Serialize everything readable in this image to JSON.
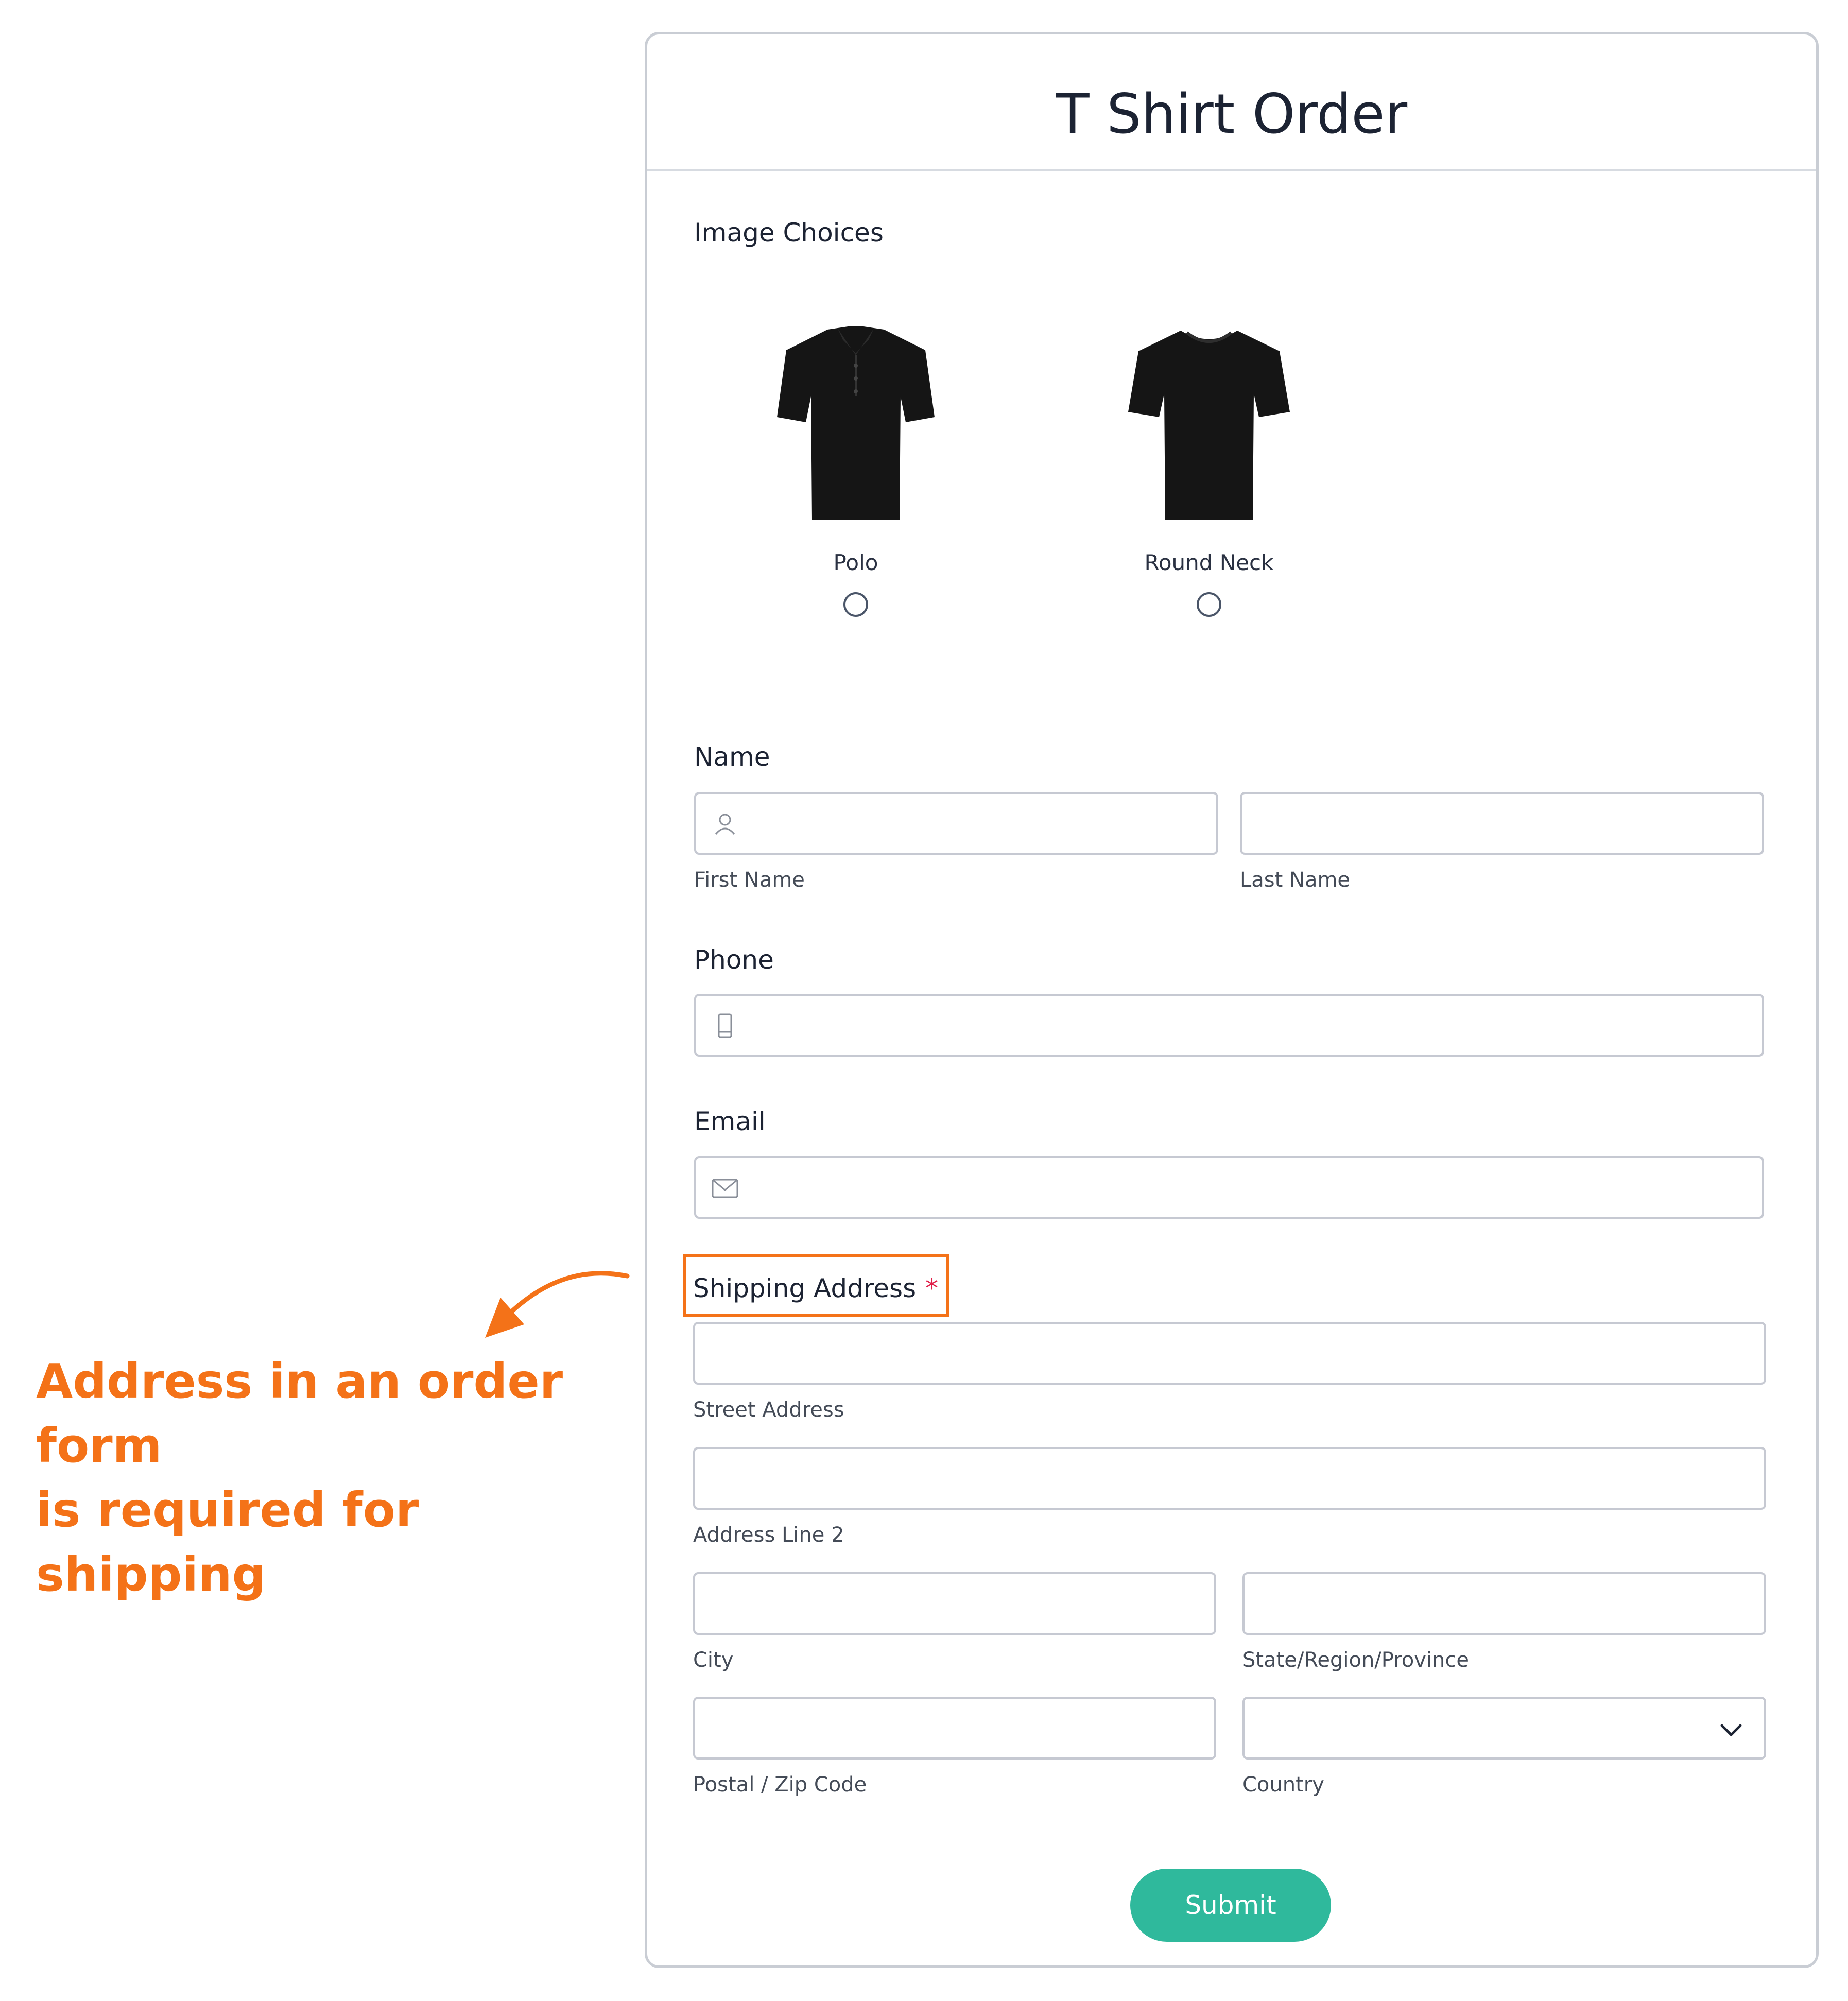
{
  "annotation": {
    "line1": "Address in an order form",
    "line2": "is required for shipping",
    "color": "#f47218"
  },
  "form": {
    "title": "T Shirt Order",
    "image_choices": {
      "label": "Image Choices",
      "options": [
        {
          "label": "Polo",
          "icon": "polo-shirt-icon",
          "selected": false
        },
        {
          "label": "Round Neck",
          "icon": "round-neck-shirt-icon",
          "selected": false
        }
      ]
    },
    "name": {
      "label": "Name",
      "first_name": {
        "sublabel": "First Name",
        "value": "",
        "icon": "user-icon"
      },
      "last_name": {
        "sublabel": "Last Name",
        "value": ""
      }
    },
    "phone": {
      "label": "Phone",
      "value": "",
      "icon": "phone-icon"
    },
    "email": {
      "label": "Email",
      "value": "",
      "icon": "mail-icon"
    },
    "shipping_address": {
      "label": "Shipping Address",
      "required_marker": "*",
      "street": {
        "sublabel": "Street Address",
        "value": ""
      },
      "line2": {
        "sublabel": "Address Line 2",
        "value": ""
      },
      "city": {
        "sublabel": "City",
        "value": ""
      },
      "state": {
        "sublabel": "State/Region/Province",
        "value": ""
      },
      "postal": {
        "sublabel": "Postal / Zip Code",
        "value": ""
      },
      "country": {
        "sublabel": "Country",
        "value": "",
        "icon": "chevron-down-icon"
      }
    },
    "submit_label": "Submit",
    "colors": {
      "accent": "#2fb99c",
      "required": "#e11d48",
      "highlight": "#f47218"
    }
  }
}
